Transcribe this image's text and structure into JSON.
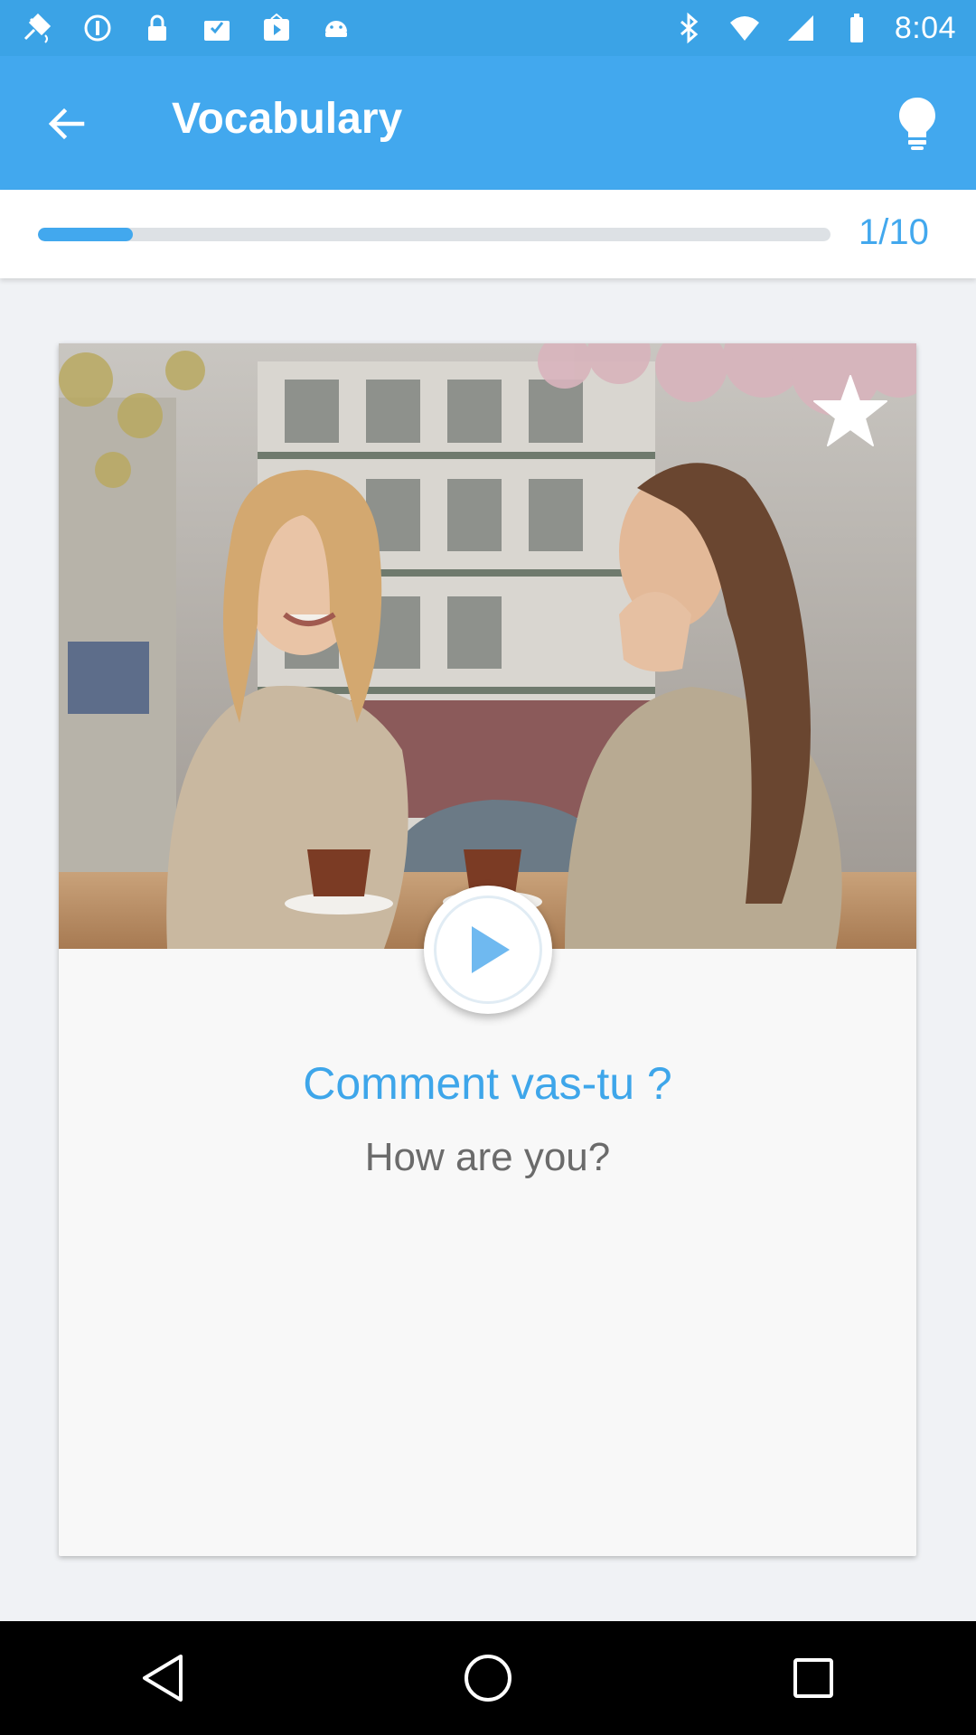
{
  "status_bar": {
    "time": "8:04",
    "left_icons": [
      "fake-gps-icon",
      "data-saver-icon",
      "lock-icon",
      "inbox-icon",
      "youtube-icon",
      "android-icon"
    ],
    "right_icons": [
      "bluetooth-icon",
      "wifi-icon",
      "signal-icon",
      "battery-icon"
    ]
  },
  "app_bar": {
    "title": "Vocabulary",
    "back_icon": "arrow-back-icon",
    "hint_icon": "lightbulb-icon"
  },
  "progress": {
    "current": 1,
    "total": 10,
    "label": "1/10",
    "fraction": 0.1
  },
  "card": {
    "phrase": "Comment vas-tu ?",
    "translation": "How are you?",
    "favorite_icon": "star-icon",
    "play_icon": "play-icon"
  },
  "colors": {
    "accent": "#42a8ee",
    "status_bar": "#3ba3e6",
    "phrase": "#3ea6ea",
    "translation": "#6b6b6b"
  },
  "nav_bar": {
    "icons": [
      "back-triangle-icon",
      "home-circle-icon",
      "recents-square-icon"
    ]
  }
}
